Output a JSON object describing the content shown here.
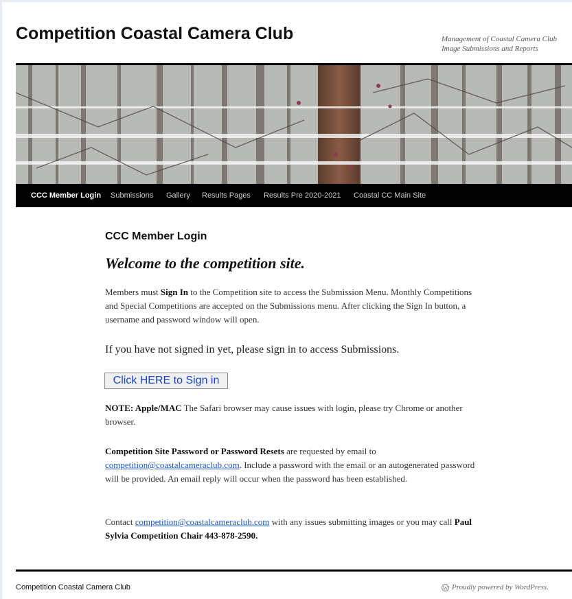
{
  "site": {
    "title": "Competition Coastal Camera Club",
    "tagline_line1": "Management of Coastal Camera Club",
    "tagline_line2": "Image Submissions and Reports"
  },
  "nav": {
    "items": [
      {
        "label": "CCC Member Login",
        "active": true
      },
      {
        "label": "Submissions"
      },
      {
        "label": "Gallery"
      },
      {
        "label": "Results Pages"
      },
      {
        "label": "Results Pre 2020-2021"
      },
      {
        "label": "Coastal CC Main Site"
      }
    ]
  },
  "content": {
    "page_title": "CCC Member Login",
    "welcome": "Welcome to the competition site.",
    "p1": {
      "prefix": "Members must ",
      "bold": "Sign In",
      "suffix": " to the Competition site to access the Submission Menu. Monthly Competitions and Special Competitions are accepted on the Submissions menu. After clicking the Sign In button, a username and password window will open."
    },
    "notice": "If you have not signed in yet, please sign in to access Submissions.",
    "signin_button": "Click HERE to Sign in",
    "note": {
      "bold": "NOTE: Apple/MAC",
      "text": " The Safari browser may cause issues with login, please try Chrome or another browser."
    },
    "reset": {
      "bold": "Competition Site Password or Password Resets",
      "text1": " are requested by email to ",
      "email": "competition@coastalcameraclub.com",
      "text2": ". Include a password with the email or an autogenerated password will be provided. An email reply will occur when the password has been established."
    },
    "contact": {
      "text1": "Contact ",
      "email": "competition@coastalcameraclub.com",
      "text2": " with any issues submitting images or you may call ",
      "bold": "Paul Sylvia Competition Chair 443-878-2590."
    }
  },
  "footer": {
    "site_name": "Competition Coastal Camera Club",
    "powered": "Proudly powered by WordPress."
  }
}
